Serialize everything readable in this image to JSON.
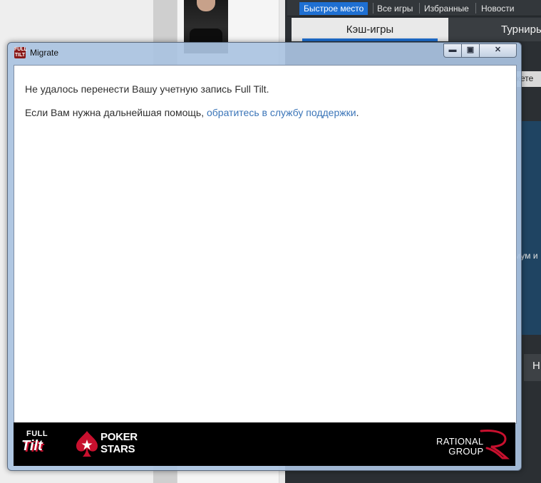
{
  "background_app": {
    "tabs": [
      "Быстрое место",
      "Все игры",
      "Избранные",
      "Новости"
    ],
    "active_tab": "Быстрое место",
    "cash_games_label": "Кэш-игры",
    "tournaments_label": "Турниры",
    "fragment_a": "жете",
    "fragment_b": "мум и",
    "fragment_c": "Н"
  },
  "window": {
    "title": "Migrate",
    "app_icon_text": "FULL TILT",
    "minimize_symbol": "▬",
    "maximize_symbol": "▣",
    "close_symbol": "✕"
  },
  "content": {
    "error_message": "Не удалось перенести Вашу учетную запись Full Tilt.",
    "help_prefix": "Если Вам нужна дальнейшая помощь, ",
    "support_link": "обратитесь в службу поддержки",
    "help_suffix": "."
  },
  "footer": {
    "full_tilt_top": "FULL",
    "full_tilt_bottom": "Tilt",
    "pokerstars_line1": "POKER",
    "pokerstars_line2": "STARS",
    "rational_line1": "RATIONAL",
    "rational_line2": "GROUP"
  },
  "colors": {
    "link": "#3b75b8",
    "active_tab": "#1e6fd2",
    "pokerstars_red": "#c8102e",
    "footer_bg": "#000000"
  }
}
